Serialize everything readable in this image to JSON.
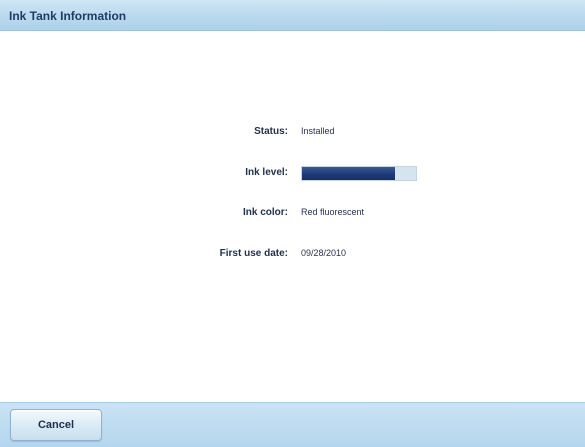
{
  "window": {
    "title": "Ink Tank Information"
  },
  "info": {
    "status_label": "Status:",
    "status_value": "Installed",
    "ink_level_label": "Ink level:",
    "ink_level_fraction": 0.82,
    "ink_color_label": "Ink color:",
    "ink_color_value": "Red fluorescent",
    "first_use_label": "First use date:",
    "first_use_value": "09/28/2010"
  },
  "footer": {
    "cancel_label": "Cancel"
  },
  "colors": {
    "title_bar": "#b9d9ee",
    "ink_fill": "#1f3a78",
    "ink_track": "#d6e4ef",
    "footer_bar": "#b4d6ed"
  }
}
